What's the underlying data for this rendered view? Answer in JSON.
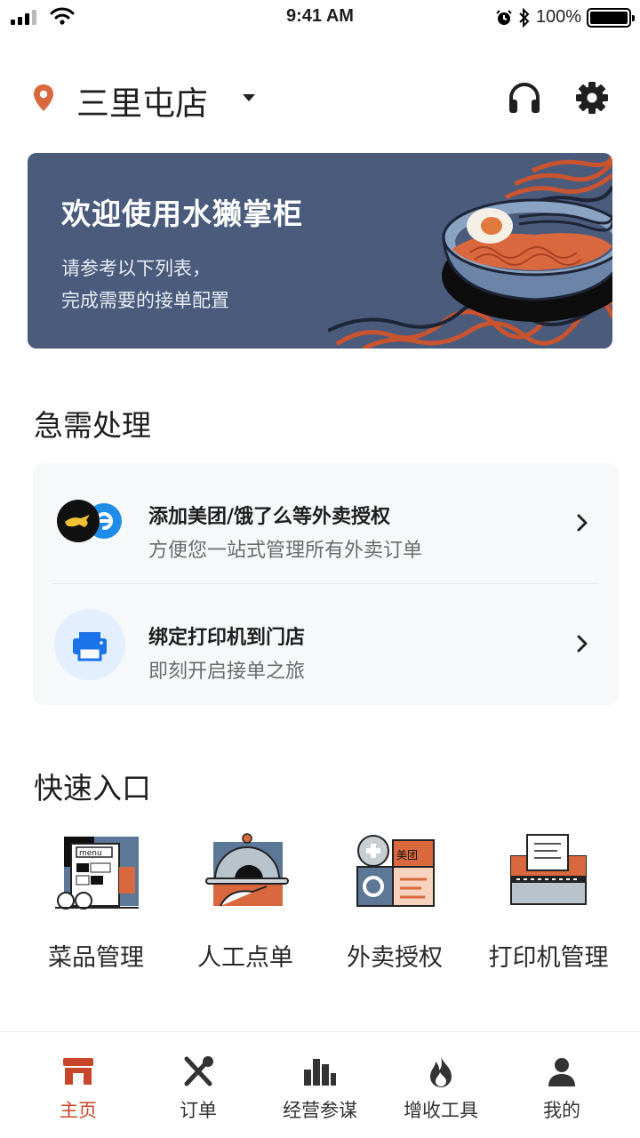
{
  "status_bar": {
    "time": "9:41 AM",
    "battery_percent": "100%"
  },
  "header": {
    "store_name": "三里屯店",
    "icons": [
      "location-pin-icon",
      "caret-down-icon",
      "headset-icon",
      "gear-icon"
    ]
  },
  "banner": {
    "title": "欢迎使用水獭掌柜",
    "subtitle_line1": "请参考以下列表，",
    "subtitle_line2": "完成需要的接单配置"
  },
  "urgent": {
    "title": "急需处理",
    "items": [
      {
        "title": "添加美团/饿了么等外卖授权",
        "desc": "方便您一站式管理所有外卖订单",
        "icon": "delivery-platforms-icon"
      },
      {
        "title": "绑定打印机到门店",
        "desc": "即刻开启接单之旅",
        "icon": "printer-icon"
      }
    ]
  },
  "quick": {
    "title": "快速入口",
    "items": [
      {
        "label": "菜品管理",
        "icon": "menu-icon"
      },
      {
        "label": "人工点单",
        "icon": "cloche-icon"
      },
      {
        "label": "外卖授权",
        "icon": "delivery-auth-icon",
        "badge": "美团"
      },
      {
        "label": "打印机管理",
        "icon": "printer-manage-icon"
      }
    ]
  },
  "quick_menu_word": "menu",
  "tabbar": {
    "items": [
      {
        "label": "主页",
        "icon": "store-icon",
        "active": true
      },
      {
        "label": "订单",
        "icon": "utensils-icon",
        "active": false
      },
      {
        "label": "经营参谋",
        "icon": "bar-chart-icon",
        "active": false
      },
      {
        "label": "增收工具",
        "icon": "flame-icon",
        "active": false
      },
      {
        "label": "我的",
        "icon": "person-icon",
        "active": false
      }
    ]
  },
  "colors": {
    "accent": "#c8442a",
    "banner_bg": "#4a5b7c",
    "card_bg": "#f6f8fa",
    "location_pin": "#d9683f",
    "printer_blue": "#1a73e8"
  }
}
